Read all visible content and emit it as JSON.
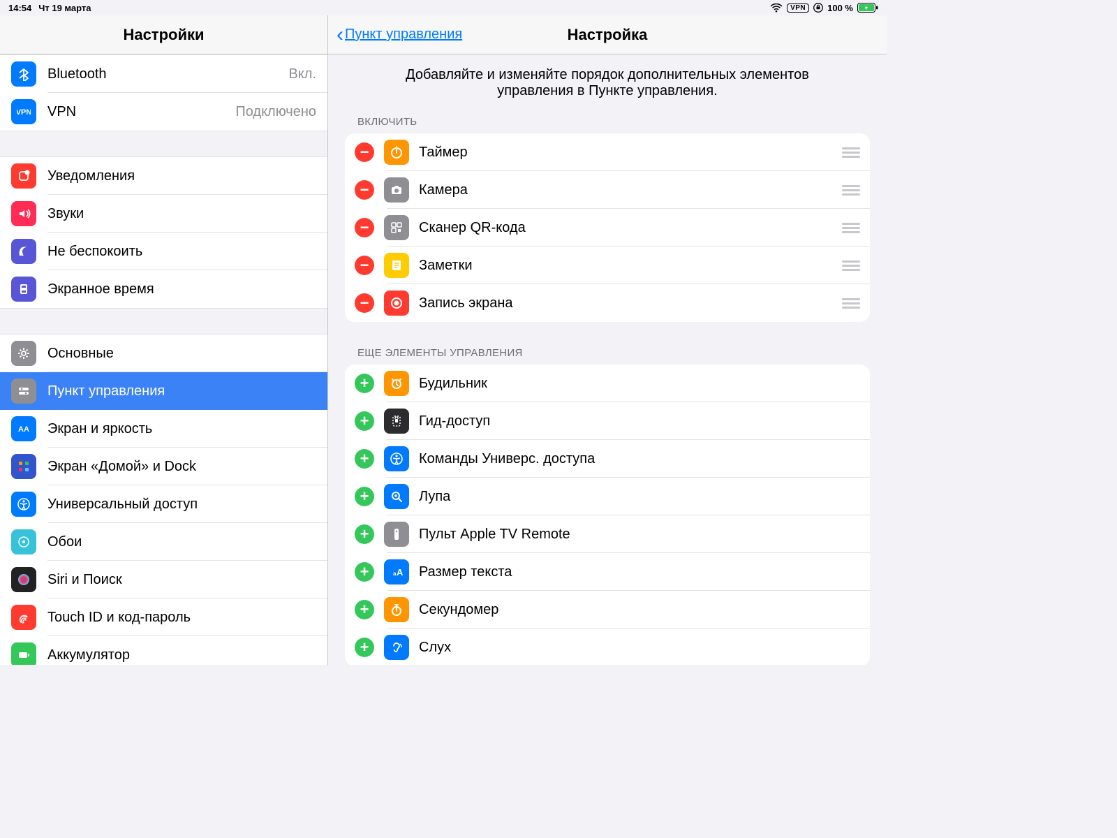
{
  "status": {
    "time": "14:54",
    "date": "Чт 19 марта",
    "vpn": "VPN",
    "battery": "100 %"
  },
  "sidebar": {
    "title": "Настройки",
    "group0": [
      {
        "label": "Bluetooth",
        "value": "Вкл.",
        "iconBg": "#007aff",
        "icon": "bluetooth"
      },
      {
        "label": "VPN",
        "value": "Подключено",
        "iconBg": "#007aff",
        "icon": "vpn"
      }
    ],
    "group1": [
      {
        "label": "Уведомления",
        "iconBg": "#ff3b30",
        "icon": "notif"
      },
      {
        "label": "Звуки",
        "iconBg": "#ff2d55",
        "icon": "sounds"
      },
      {
        "label": "Не беспокоить",
        "iconBg": "#5856d6",
        "icon": "dnd"
      },
      {
        "label": "Экранное время",
        "iconBg": "#5856d6",
        "icon": "screentime"
      }
    ],
    "group2": [
      {
        "label": "Основные",
        "iconBg": "#8e8e93",
        "icon": "gear"
      },
      {
        "label": "Пункт управления",
        "iconBg": "#8e8e93",
        "icon": "cc",
        "selected": true
      },
      {
        "label": "Экран и яркость",
        "iconBg": "#007aff",
        "icon": "display"
      },
      {
        "label": "Экран «Домой» и Dock",
        "iconBg": "#3355cc",
        "icon": "home"
      },
      {
        "label": "Универсальный доступ",
        "iconBg": "#007aff",
        "icon": "access"
      },
      {
        "label": "Обои",
        "iconBg": "#37c2d9",
        "icon": "wallpaper"
      },
      {
        "label": "Siri и Поиск",
        "iconBg": "#222",
        "icon": "siri"
      },
      {
        "label": "Touch ID и код-пароль",
        "iconBg": "#ff3b30",
        "icon": "touchid"
      },
      {
        "label": "Аккумулятор",
        "iconBg": "#34c759",
        "icon": "battery"
      }
    ]
  },
  "detail": {
    "back": "Пункт управления",
    "title": "Настройка",
    "hint": "Добавляйте и изменяйте порядок дополнительных элементов управления в Пункте управления.",
    "includeTitle": "ВКЛЮЧИТЬ",
    "moreTitle": "ЕЩЕ ЭЛЕМЕНТЫ УПРАВЛЕНИЯ",
    "included": [
      {
        "label": "Таймер",
        "iconBg": "#ff9500",
        "icon": "timer"
      },
      {
        "label": "Камера",
        "iconBg": "#8e8e93",
        "icon": "camera"
      },
      {
        "label": "Сканер QR-кода",
        "iconBg": "#8e8e93",
        "icon": "qr"
      },
      {
        "label": "Заметки",
        "iconBg": "#ffcc00",
        "icon": "notes"
      },
      {
        "label": "Запись экрана",
        "iconBg": "#ff3b30",
        "icon": "record"
      }
    ],
    "more": [
      {
        "label": "Будильник",
        "iconBg": "#ff9500",
        "icon": "alarm"
      },
      {
        "label": "Гид-доступ",
        "iconBg": "#2c2c2e",
        "icon": "guided"
      },
      {
        "label": "Команды Универс. доступа",
        "iconBg": "#007aff",
        "icon": "access"
      },
      {
        "label": "Лупа",
        "iconBg": "#007aff",
        "icon": "magnifier"
      },
      {
        "label": "Пульт Apple TV Remote",
        "iconBg": "#8e8e93",
        "icon": "remote"
      },
      {
        "label": "Размер текста",
        "iconBg": "#007aff",
        "icon": "textsize"
      },
      {
        "label": "Секундомер",
        "iconBg": "#ff9500",
        "icon": "stopwatch"
      },
      {
        "label": "Слух",
        "iconBg": "#007aff",
        "icon": "hearing"
      }
    ]
  }
}
